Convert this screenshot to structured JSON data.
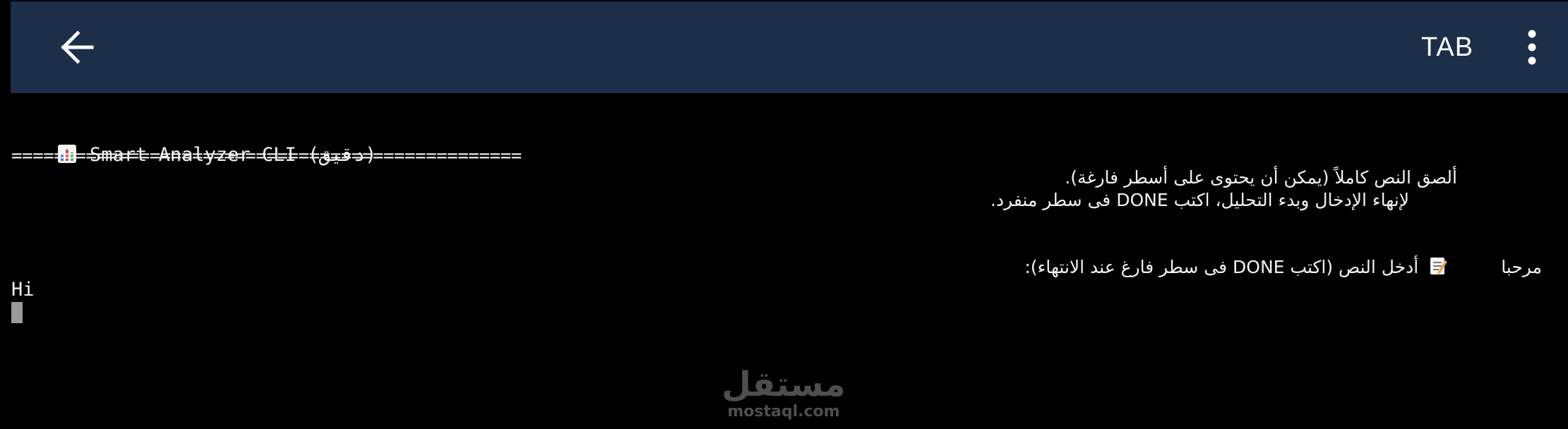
{
  "header": {
    "back_icon": "arrow-left-icon",
    "tab_label": "TAB",
    "menu_icon": "more-vertical-icon",
    "background_color": "#1c2e48"
  },
  "terminal": {
    "title_icon": "bar-chart-emoji",
    "title_text": "Smart Analyzer CLI (دقيق)",
    "separator": "================================================",
    "instruction_line1": "ألصق النص كاملاً (يمكن أن يحتوى على أسطر فارغة).",
    "instruction_line2": "لإنهاء الإدخال وبدء التحليل، اكتب DONE فى سطر منفرد.",
    "prompt_icon": "memo-emoji",
    "prompt_text": "أدخل النص (اكتب DONE فى سطر فارغ عند الانتهاء):",
    "input_line1": "مرحبا",
    "input_line2": "Hi"
  },
  "watermark": {
    "arabic": "مستقل",
    "latin": "mostaql.com"
  }
}
